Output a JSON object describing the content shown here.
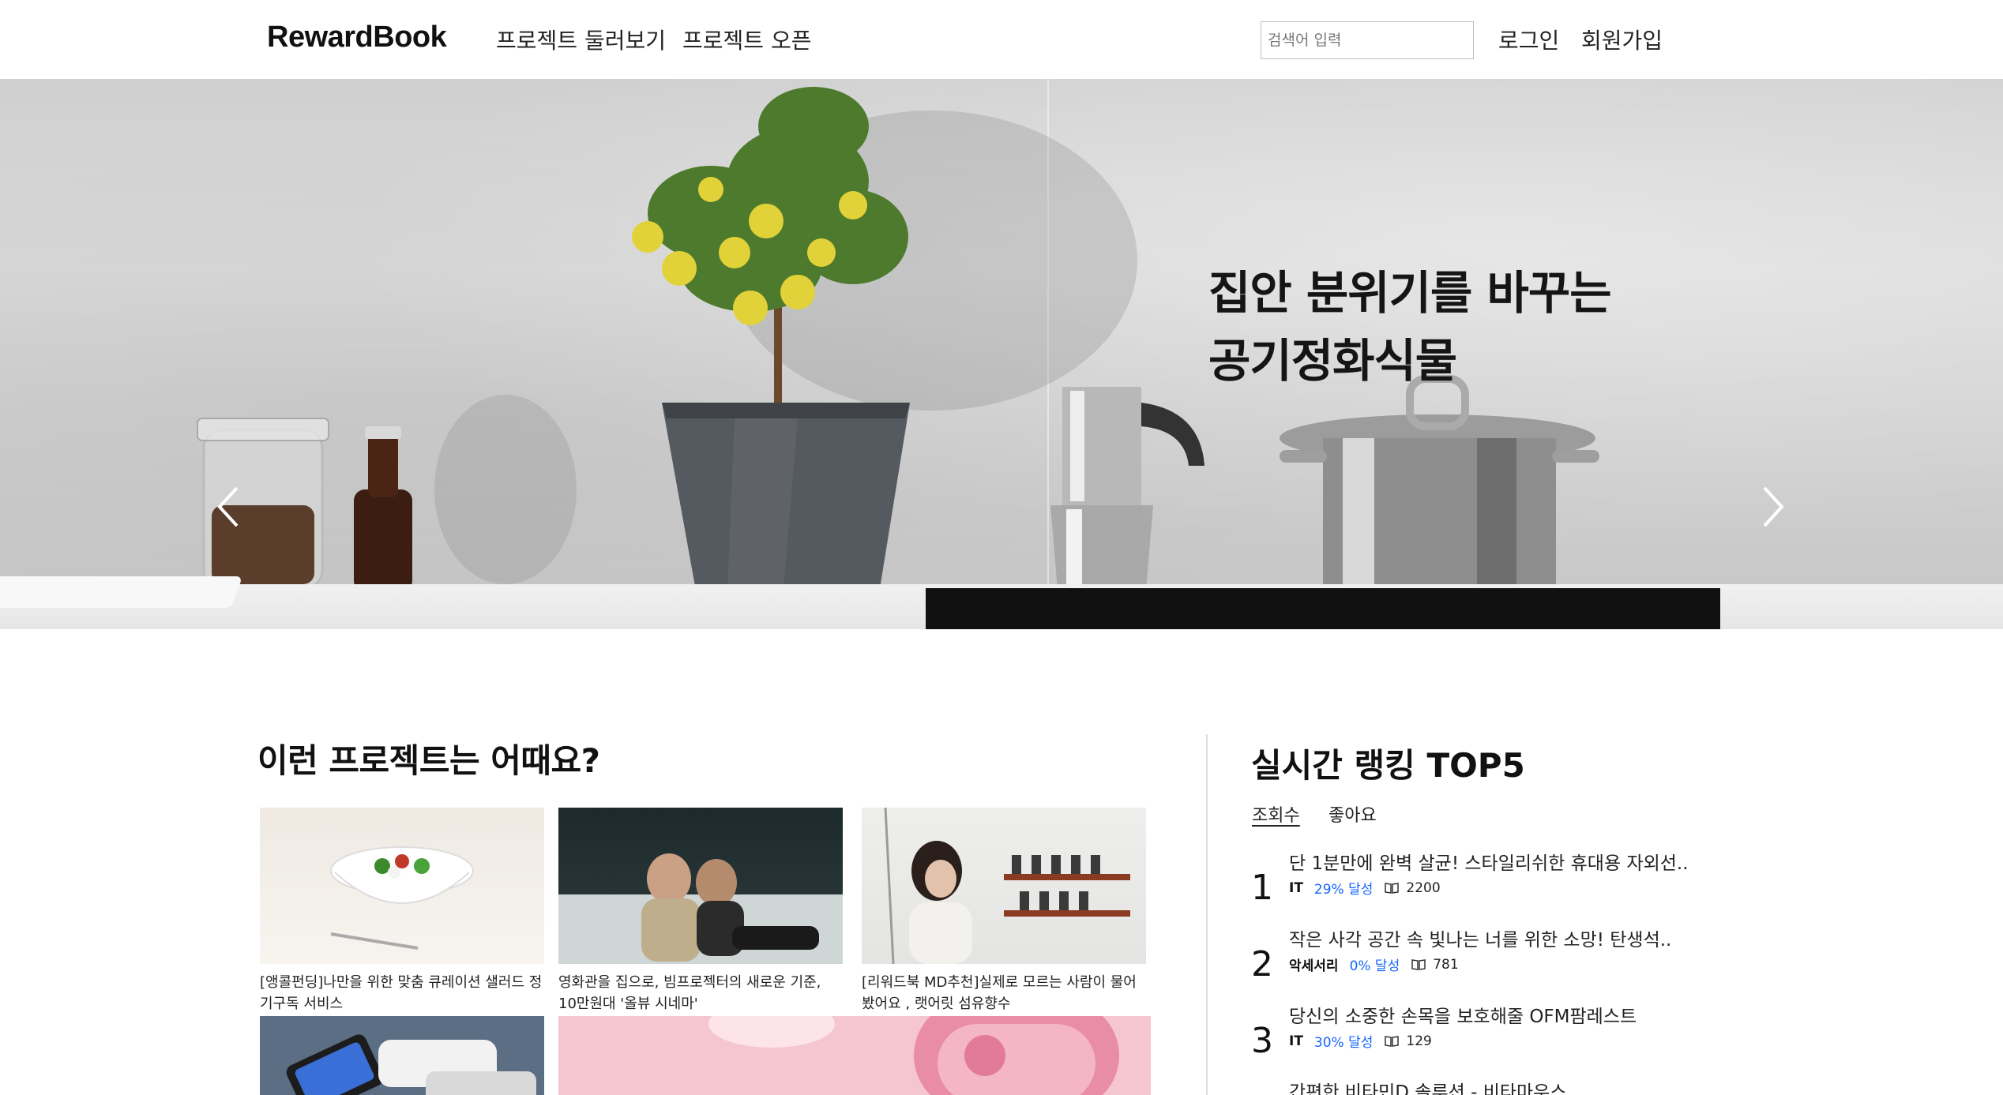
{
  "header": {
    "logo": "RewardBook",
    "nav": [
      "프로젝트 둘러보기",
      "프로젝트 오픈"
    ],
    "search_placeholder": "검색어 입력",
    "login": "로그인",
    "signup": "회원가입"
  },
  "hero": {
    "title_line1": "집안 분위기를 바꾸는",
    "title_line2": "공기정화식물"
  },
  "recommend": {
    "title": "이런 프로젝트는 어때요?",
    "cards": [
      {
        "caption": "[앵콜펀딩]나만을 위한 맞춤 큐레이션 샐러드 정기구독 서비스"
      },
      {
        "caption": "영화관을 집으로, 빔프로젝터의 새로운 기준, 10만원대 '올뷰 시네마'"
      },
      {
        "caption": "[리워드북 MD추천]실제로 모르는 사람이 물어봤어요 , 랫어릿 섬유향수"
      }
    ]
  },
  "ranking": {
    "title": "실시간 랭킹 TOP5",
    "tabs": [
      "조회수",
      "좋아요"
    ],
    "items": [
      {
        "rank": "1",
        "name": "단 1분만에 완벽 살균! 스타일리쉬한 휴대용 자외선..",
        "category": "IT",
        "rate": "29% 달성",
        "views": "2200"
      },
      {
        "rank": "2",
        "name": "작은 사각 공간 속 빛나는 너를 위한 소망! 탄생석..",
        "category": "악세서리",
        "rate": "0% 달성",
        "views": "781"
      },
      {
        "rank": "3",
        "name": "당신의 소중한 손목을 보호해줄 OFM팜레스트",
        "category": "IT",
        "rate": "30% 달성",
        "views": "129"
      },
      {
        "rank": "",
        "name": "간편한 비타민D 솔루션 - 비타마우스",
        "category": "",
        "rate": "",
        "views": ""
      }
    ]
  },
  "colors": {
    "accent": "#1565ff"
  }
}
